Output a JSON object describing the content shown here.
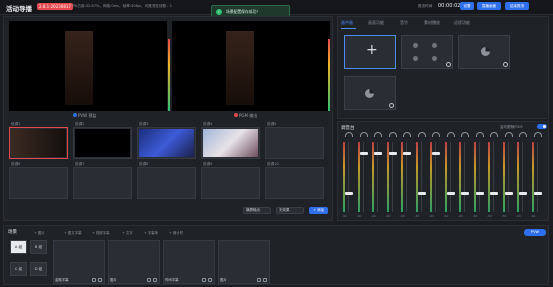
{
  "header": {
    "title": "活动导播",
    "version": "2.8.1-20230817",
    "sysinfo": "CPU占用:32.67%，网络:0ms，帧率:30fps，可推流在线数：1",
    "timer_label": "推流时间",
    "timer": "00:00:02",
    "buttons": [
      "设置",
      "直播画面",
      "结束推流"
    ]
  },
  "toast": {
    "message": "场景配置保存成功！"
  },
  "monitors": {
    "pvw_label": "PVW 预监",
    "pgm_label": "PGM 输出"
  },
  "slots": [
    {
      "label": "信源1"
    },
    {
      "label": "信源2"
    },
    {
      "label": "信源3"
    },
    {
      "label": "信源4"
    },
    {
      "label": "信源5"
    },
    {
      "label": "信源6"
    },
    {
      "label": "信源7"
    },
    {
      "label": "信源8"
    },
    {
      "label": "信源9"
    },
    {
      "label": "信源10"
    }
  ],
  "controls": {
    "select1": "横屏输出",
    "select2": "无效果",
    "add": "+ 添加"
  },
  "right_tabs": [
    "画中画",
    "画面功能",
    "音竹",
    "素材播放",
    "远程功能"
  ],
  "mixer": {
    "title": "调音台",
    "toggle_label": "监听跟随PGM",
    "channels": [
      "",
      "",
      "",
      "",
      "",
      "",
      "",
      "",
      "",
      "",
      "",
      "",
      "",
      ""
    ],
    "db": "-60"
  },
  "scene": {
    "title": "场景",
    "buttons": [
      "+ 图片",
      "+ 图文字幕",
      "+ 视频字幕",
      "+ 文字",
      "+ 字幕条",
      "+ 倒计时"
    ],
    "pvw": "PVW",
    "layout_tiles": [
      "A 组",
      "B 组",
      "C 组",
      "D 组"
    ],
    "cards": [
      "金融字幕",
      "图片",
      "时间字幕",
      "图片"
    ]
  },
  "colors": {
    "accent": "#2f6fed",
    "danger": "#e5484d",
    "success": "#2fbf71"
  }
}
